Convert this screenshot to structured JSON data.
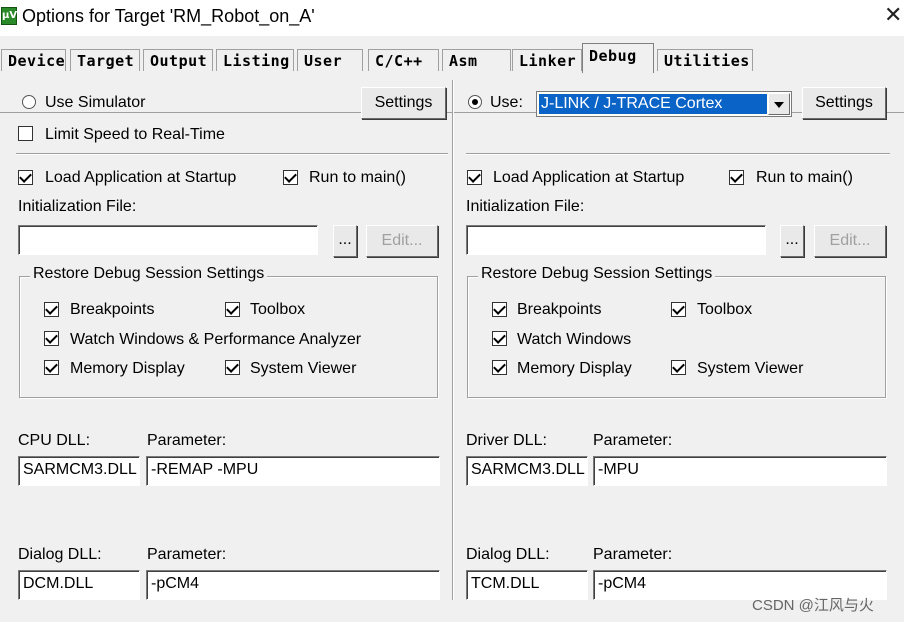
{
  "window": {
    "title": "Options for Target 'RM_Robot_on_A'",
    "icon": "uvision-app-icon",
    "close_glyph": "✕"
  },
  "tabs": [
    {
      "label": "Device",
      "active": false
    },
    {
      "label": "Target",
      "active": false
    },
    {
      "label": "Output",
      "active": false
    },
    {
      "label": "Listing",
      "active": false
    },
    {
      "label": "User",
      "active": false
    },
    {
      "label": "C/C++",
      "active": false
    },
    {
      "label": "Asm",
      "active": false
    },
    {
      "label": "Linker",
      "active": false
    },
    {
      "label": "Debug",
      "active": true
    },
    {
      "label": "Utilities",
      "active": false
    }
  ],
  "left": {
    "use_simulator": {
      "label": "Use Simulator",
      "selected": false
    },
    "limit_speed": {
      "label": "Limit Speed to Real-Time",
      "checked": false
    },
    "settings_label": "Settings",
    "load_app": {
      "label": "Load Application at Startup",
      "checked": true
    },
    "run_to_main": {
      "label": "Run to main()",
      "checked": true
    },
    "init_file_label": "Initialization File:",
    "init_file_value": "",
    "browse_label": "...",
    "edit_label": "Edit...",
    "restore": {
      "title": "Restore Debug Session Settings",
      "breakpoints": {
        "label": "Breakpoints",
        "checked": true
      },
      "toolbox": {
        "label": "Toolbox",
        "checked": true
      },
      "watch": {
        "label": "Watch Windows & Performance Analyzer",
        "checked": true
      },
      "memory": {
        "label": "Memory Display",
        "checked": true
      },
      "sysviewer": {
        "label": "System Viewer",
        "checked": true
      }
    },
    "cpu_dll_label": "CPU DLL:",
    "cpu_dll_value": "SARMCM3.DLL",
    "cpu_param_label": "Parameter:",
    "cpu_param_value": "-REMAP -MPU",
    "dialog_dll_label": "Dialog DLL:",
    "dialog_dll_value": "DCM.DLL",
    "dialog_param_label": "Parameter:",
    "dialog_param_value": "-pCM4"
  },
  "right": {
    "use": {
      "label": "Use:",
      "selected": true
    },
    "debugger_value": "J-LINK / J-TRACE Cortex",
    "settings_label": "Settings",
    "load_app": {
      "label": "Load Application at Startup",
      "checked": true
    },
    "run_to_main": {
      "label": "Run to main()",
      "checked": true
    },
    "init_file_label": "Initialization File:",
    "init_file_value": "",
    "browse_label": "...",
    "edit_label": "Edit...",
    "restore": {
      "title": "Restore Debug Session Settings",
      "breakpoints": {
        "label": "Breakpoints",
        "checked": true
      },
      "toolbox": {
        "label": "Toolbox",
        "checked": true
      },
      "watch": {
        "label": "Watch Windows",
        "checked": true
      },
      "memory": {
        "label": "Memory Display",
        "checked": true
      },
      "sysviewer": {
        "label": "System Viewer",
        "checked": true
      }
    },
    "driver_dll_label": "Driver DLL:",
    "driver_dll_value": "SARMCM3.DLL",
    "driver_param_label": "Parameter:",
    "driver_param_value": "-MPU",
    "dialog_dll_label": "Dialog DLL:",
    "dialog_dll_value": "TCM.DLL",
    "dialog_param_label": "Parameter:",
    "dialog_param_value": "-pCM4"
  },
  "watermark": "CSDN @江风与火"
}
